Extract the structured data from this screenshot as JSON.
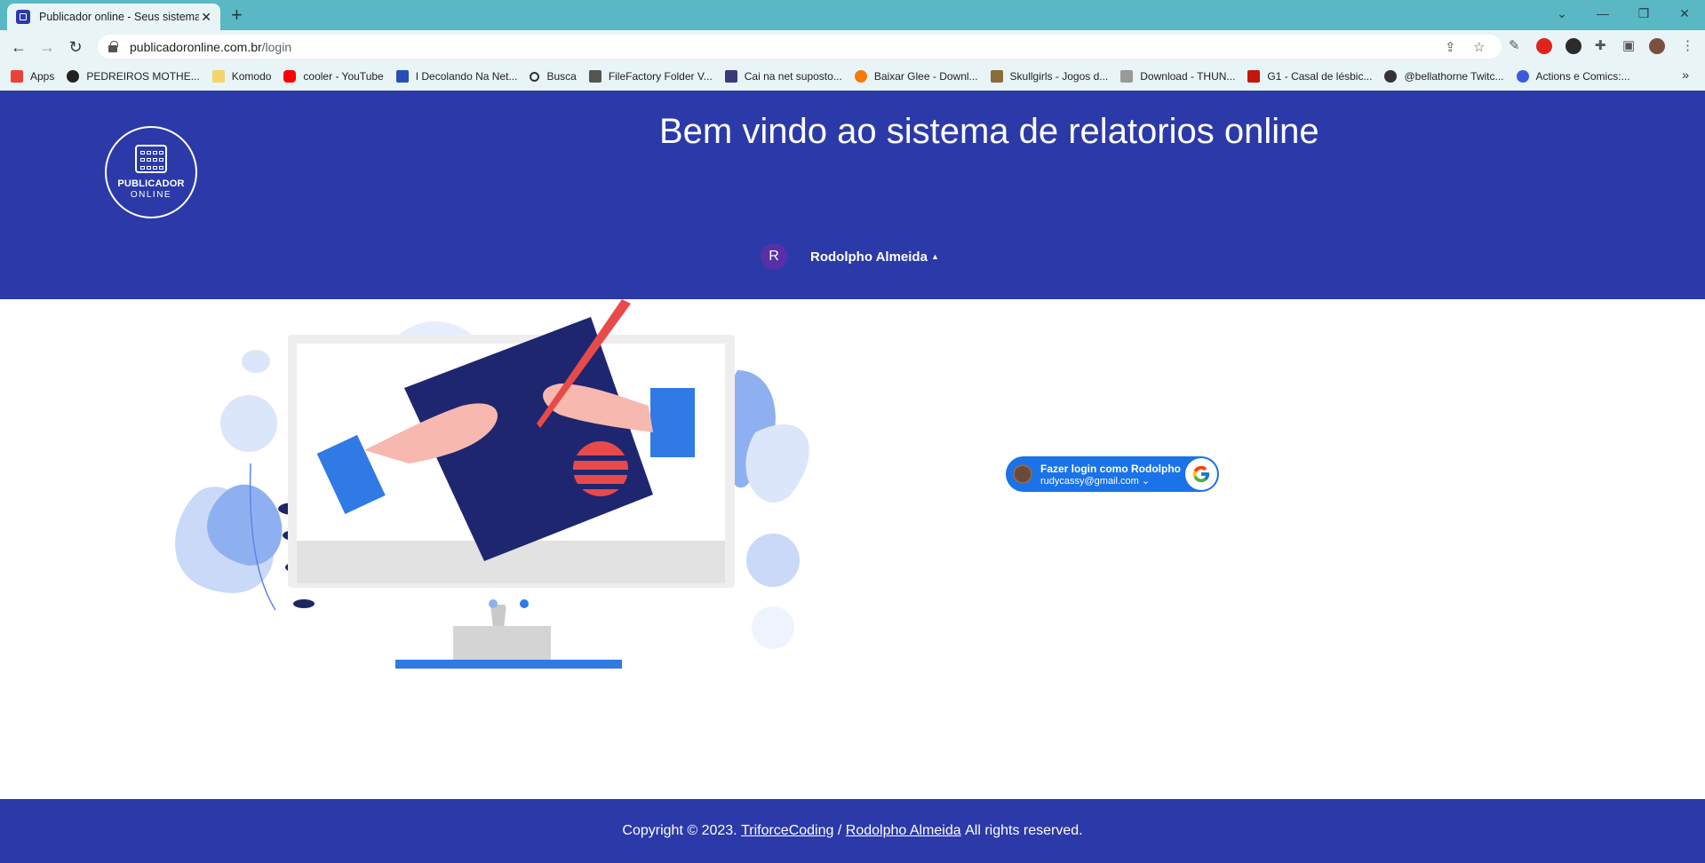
{
  "browser": {
    "tab": {
      "title": "Publicador online - Seus sistema"
    },
    "address": {
      "domain": "publicadoronline.com.br",
      "path": "/login"
    }
  },
  "bookmarks": [
    {
      "label": "Apps",
      "icon": "apps-grid-icon",
      "color": "#ea4335"
    },
    {
      "label": "PEDREIROS MOTHE...",
      "icon": "globe-icon",
      "color": "#222222"
    },
    {
      "label": "Komodo",
      "icon": "folder-icon",
      "color": "#f4d46a"
    },
    {
      "label": "cooler - YouTube",
      "icon": "youtube-icon",
      "color": "#ff0000"
    },
    {
      "label": "I Decolando Na Net...",
      "icon": "s-logo-icon",
      "color": "#2a4db5"
    },
    {
      "label": "Busca",
      "icon": "search-icon",
      "color": "#333333"
    },
    {
      "label": "FileFactory Folder V...",
      "icon": "filefactory-icon",
      "color": "#555555"
    },
    {
      "label": "Cai na net suposto...",
      "icon": "m-logo-icon",
      "color": "#3a3a7a"
    },
    {
      "label": "Baixar Glee - Downl...",
      "icon": "chart-logo-icon",
      "color": "#f57c00"
    },
    {
      "label": "Skullgirls - Jogos d...",
      "icon": "t-logo-icon",
      "color": "#8a6d3b"
    },
    {
      "label": "Download - THUN...",
      "icon": "download-icon",
      "color": "#666666"
    },
    {
      "label": "G1 - Casal de lésbic...",
      "icon": "g1-logo-icon",
      "color": "#c4170c"
    },
    {
      "label": "@bellathorne Twitc...",
      "icon": "profile-icon",
      "color": "#333333"
    },
    {
      "label": "Actions e Comics:...",
      "icon": "comic-icon",
      "color": "#3b5bdb"
    }
  ],
  "header": {
    "logo": {
      "title": "PUBLICADOR",
      "subtitle": "ONLINE"
    },
    "welcome": "Bem vindo ao sistema de relatorios online",
    "user": {
      "initial": "R",
      "name": "Rodolpho Almeida"
    }
  },
  "google_login": {
    "line1": "Fazer login como Rodolpho",
    "email": "rudycassy@gmail.com"
  },
  "footer": {
    "prefix": "Copyright © 2023.",
    "link1": "TriforceCoding",
    "separator": "/",
    "link2": "Rodolpho Almeida",
    "suffix": "All rights reserved."
  },
  "colors": {
    "brand": "#2b3aa8",
    "tabstrip": "#5ab8c4",
    "google_blue": "#1a73e8"
  }
}
